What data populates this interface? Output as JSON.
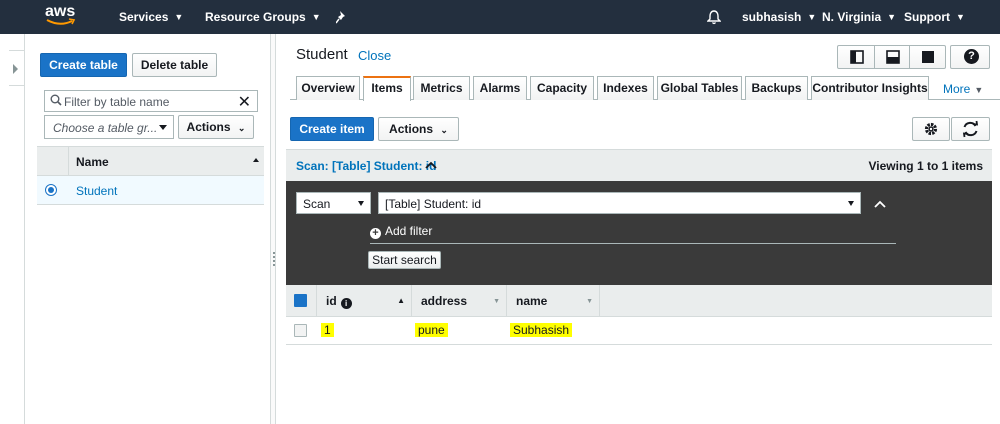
{
  "topnav": {
    "logo_text": "aws",
    "services": "Services",
    "resource_groups": "Resource Groups",
    "user": "subhasish",
    "region": "N. Virginia",
    "support": "Support"
  },
  "left": {
    "create_table": "Create table",
    "delete_table": "Delete table",
    "filter_placeholder": "Filter by table name",
    "group_placeholder": "Choose a table gr...",
    "actions": "Actions",
    "column_header": "Name",
    "tables": [
      {
        "name": "Student",
        "selected": true
      }
    ]
  },
  "right": {
    "title": "Student",
    "close": "Close",
    "tabs": [
      {
        "label": "Overview"
      },
      {
        "label": "Items",
        "active": true
      },
      {
        "label": "Metrics"
      },
      {
        "label": "Alarms"
      },
      {
        "label": "Capacity"
      },
      {
        "label": "Indexes"
      },
      {
        "label": "Global Tables"
      },
      {
        "label": "Backups"
      },
      {
        "label": "Contributor Insights"
      }
    ],
    "more": "More",
    "create_item": "Create item",
    "actions": "Actions",
    "scan_label": "Scan: [Table] Student: id",
    "viewing": "Viewing 1 to 1 items",
    "scan_mode": "Scan",
    "scan_target": "[Table] Student: id",
    "add_filter": "Add filter",
    "start_search": "Start search",
    "columns": [
      {
        "name": "id",
        "info": true
      },
      {
        "name": "address"
      },
      {
        "name": "name"
      }
    ],
    "rows": [
      {
        "id": "1",
        "address": "pune",
        "name": "Subhasish"
      }
    ]
  },
  "colors": {
    "nav_bg": "#232f3e",
    "primary": "#1a73c7",
    "link": "#0073bb",
    "tab_accent": "#ec7211",
    "highlight": "#ffff00",
    "scan_panel": "#3a3a3a"
  }
}
